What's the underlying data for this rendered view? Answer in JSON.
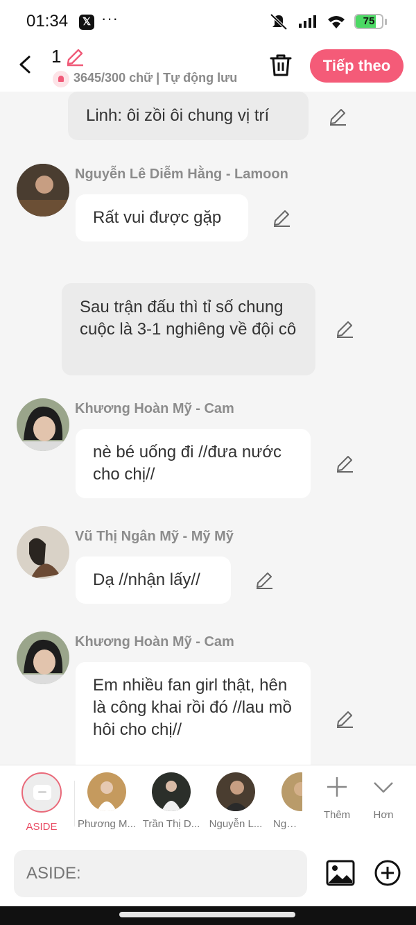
{
  "status": {
    "time": "01:34",
    "app_badge": "𝕏",
    "more": "···",
    "battery": "75"
  },
  "header": {
    "title": "1",
    "word_count": "3645/300 chữ | Tự động lưu",
    "next_label": "Tiếp theo"
  },
  "messages": [
    {
      "type": "aside",
      "text": "Linh: ôi zồi ôi chung vị trí"
    },
    {
      "type": "char",
      "speaker": "Nguyễn Lê Diễm Hằng - Lamoon",
      "text": "Rất vui được gặp"
    },
    {
      "type": "aside",
      "text": "Sau trận đấu thì tỉ số chung cuộc là 3-1 nghiêng về đội cô"
    },
    {
      "type": "char",
      "speaker": "Khương Hoàn Mỹ - Cam",
      "text": "nè bé uống đi //đưa nước cho chị//"
    },
    {
      "type": "char",
      "speaker": "Vũ Thị Ngân Mỹ - Mỹ Mỹ",
      "text": "Dạ //nhận lấy//"
    },
    {
      "type": "char",
      "speaker": "Khương Hoàn Mỹ - Cam",
      "text": "Em nhiều fan girl thật, hên là công khai rồi đó //lau mồ hôi cho chị//"
    }
  ],
  "characters": {
    "aside": "ASIDE",
    "items": [
      "Phương M...",
      "Trần Thị D...",
      "Nguyễn L...",
      "Nguyễ"
    ],
    "add": "Thêm",
    "more": "Hơn"
  },
  "input": {
    "placeholder": "ASIDE:"
  },
  "colors": {
    "accent": "#f45b78",
    "aside_text": "#e94a62",
    "bubble_gray": "#ebebeb"
  }
}
